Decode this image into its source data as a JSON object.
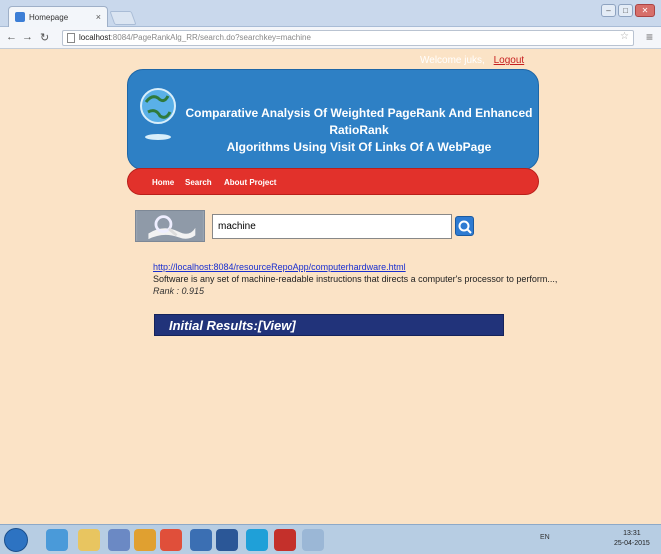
{
  "browser": {
    "tab_title": "Homepage",
    "tab_close": "×",
    "url_host": "localhost",
    "url_path": ":8084/PageRankAlg_RR/search.do?searchkey=machine"
  },
  "header": {
    "welcome_text": "Welcome juks,",
    "logout_label": "Logout",
    "title_line1": "Comparative Analysis Of Weighted PageRank And Enhanced RatioRank",
    "title_line2": "Algorithms Using Visit Of Links Of A WebPage"
  },
  "nav": {
    "items": [
      {
        "label": "Home"
      },
      {
        "label": "Search"
      },
      {
        "label": "About Project"
      }
    ]
  },
  "search": {
    "value": "machine"
  },
  "results": [
    {
      "url": "http://localhost:8084/resourceRepoApp/computerhardware.html",
      "description": "Software is any set of machine-readable instructions that directs a computer's processor to perform...,",
      "rank": "Rank : 0.915"
    }
  ],
  "initial_results": {
    "label": "Initial Results:",
    "view_label": "[View]"
  },
  "taskbar": {
    "tray_text": "EN",
    "clock_time": "13:31",
    "clock_date": "25-04-2015"
  }
}
